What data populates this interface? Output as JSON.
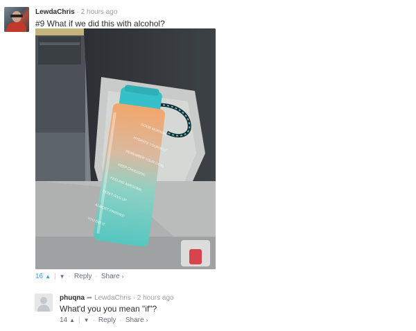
{
  "comment1": {
    "username": "LewdaChris",
    "time": "2 hours ago",
    "text": "#9 What if we did this with alcohol?",
    "image_alt": "Photo of a teal and orange gradient motivational water bottle strapped into a car seat",
    "bottle_labels": [
      "GOOD MORNING",
      "HYDRATE YOURSELF",
      "REMEMBER YOUR GOAL",
      "KEEP CHUGGING",
      "FEELING AWESOME",
      "DON'T GIVE UP",
      "ALMOST FINISHED",
      "YOU DID IT"
    ],
    "votes": "16",
    "reply_label": "Reply",
    "share_label": "Share"
  },
  "comment2": {
    "username": "phuqna",
    "reply_to": "LewdaChris",
    "time": "2 hours ago",
    "text": "What'd you you mean \"if\"?",
    "votes": "14",
    "reply_label": "Reply",
    "share_label": "Share"
  },
  "colors": {
    "vote_active": "#2e9fff",
    "muted": "#9aa1a5",
    "text": "#2a2e2e",
    "bottle_teal": "#5cc9c4",
    "bottle_orange": "#f2a66b"
  }
}
